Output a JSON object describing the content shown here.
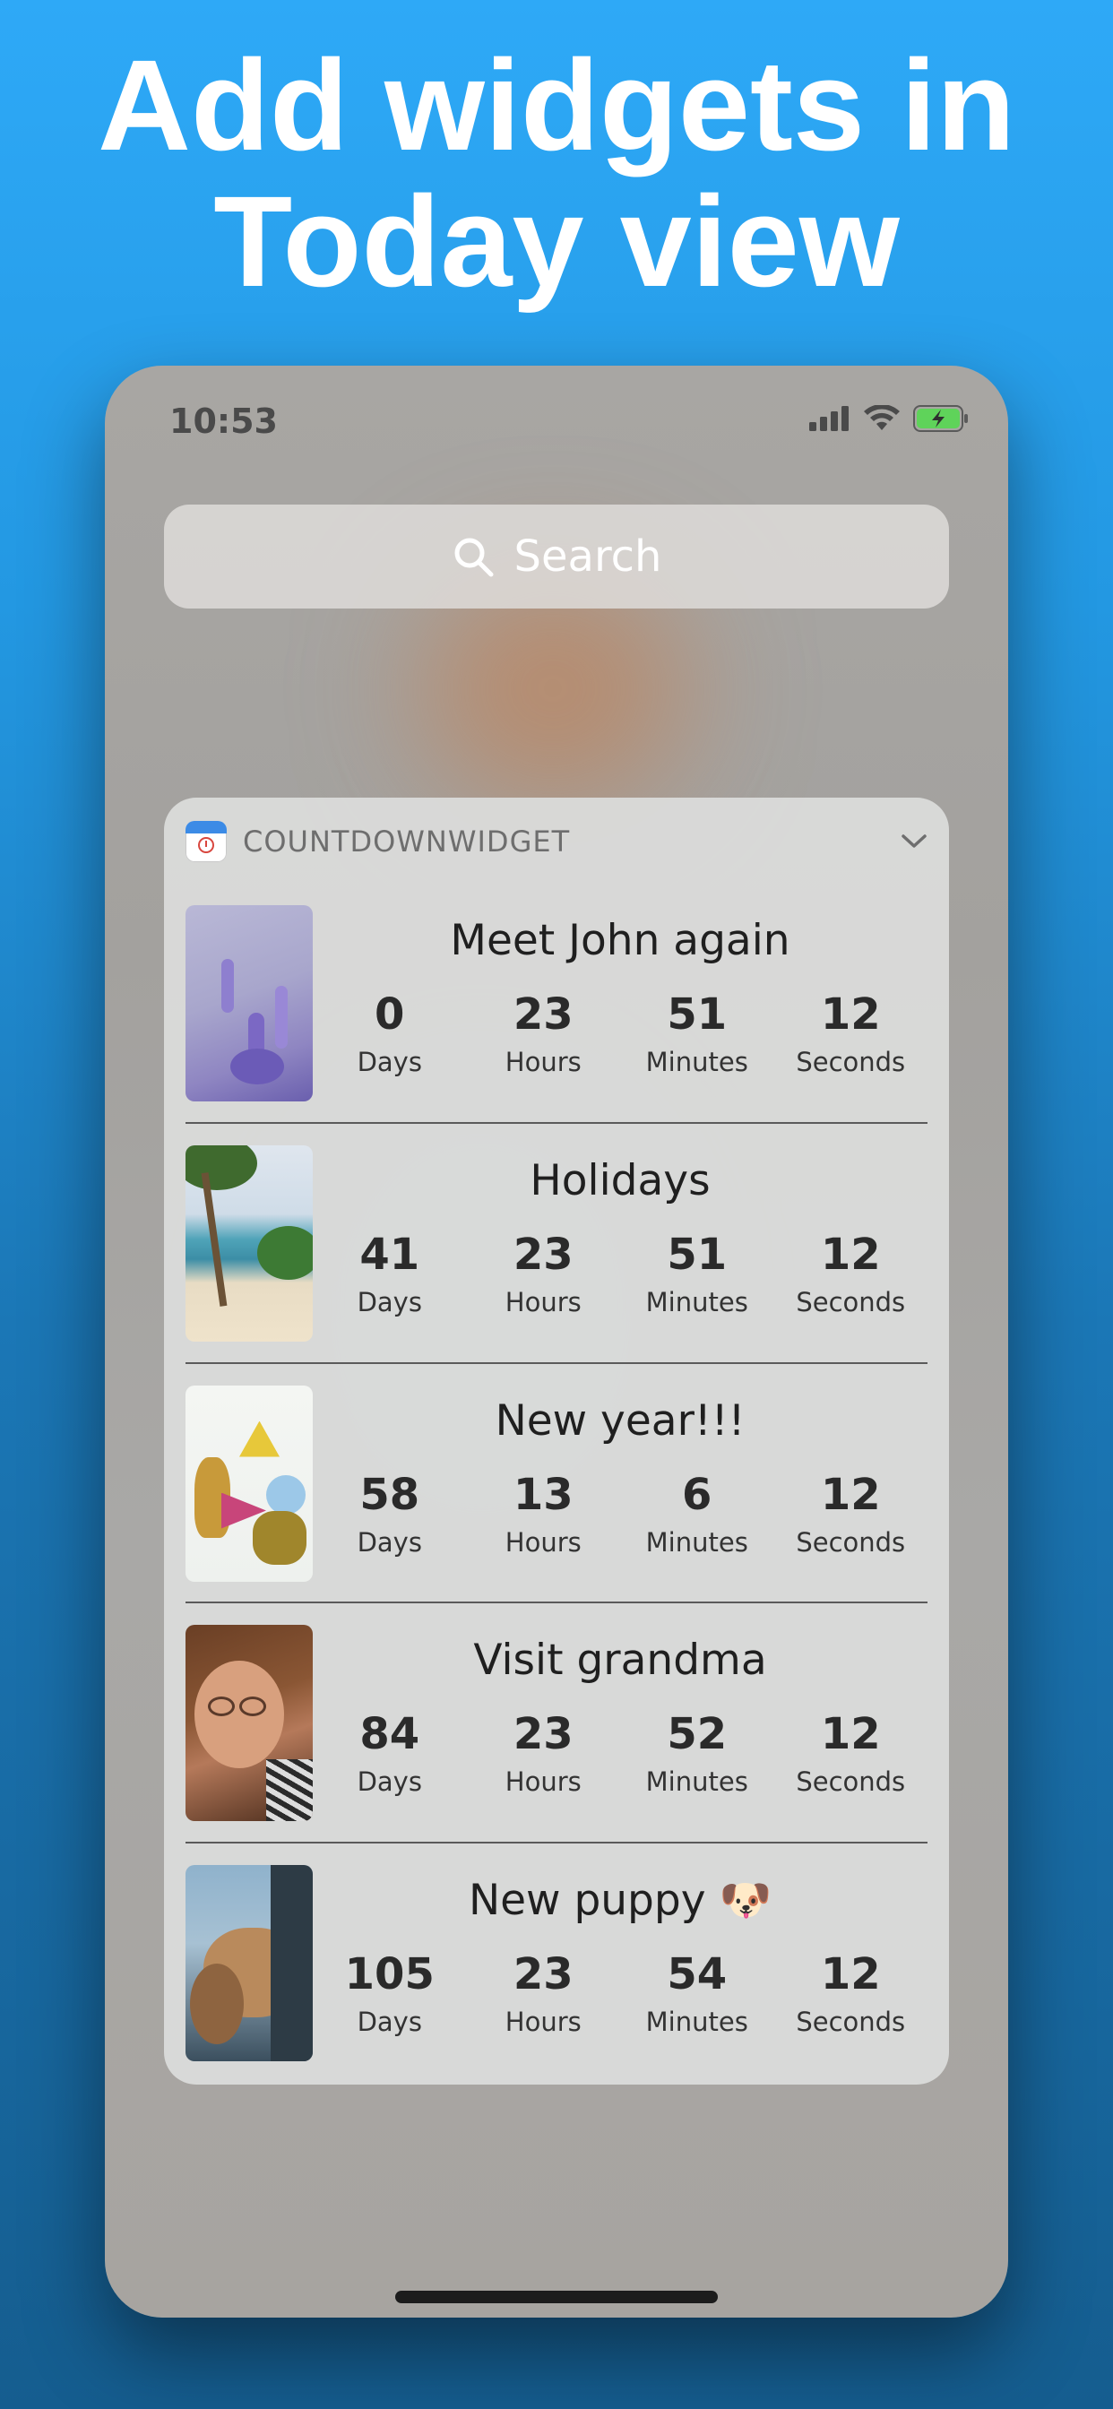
{
  "headline": {
    "line1": "Add widgets in",
    "line2": "Today view"
  },
  "status_bar": {
    "time": "10:53"
  },
  "search": {
    "label": "Search"
  },
  "widget": {
    "app_name": "COUNTDOWNWIDGET",
    "events": [
      {
        "title": "Meet John again",
        "days": "0",
        "hours": "23",
        "minutes": "51",
        "seconds": "12",
        "image": "lavender-photo"
      },
      {
        "title": "Holidays",
        "days": "41",
        "hours": "23",
        "minutes": "51",
        "seconds": "12",
        "image": "beach-palm-photo"
      },
      {
        "title": "New year!!!",
        "days": "58",
        "hours": "13",
        "minutes": "6",
        "seconds": "12",
        "image": "party-pineapples-photo"
      },
      {
        "title": "Visit grandma",
        "days": "84",
        "hours": "23",
        "minutes": "52",
        "seconds": "12",
        "image": "grandma-hug-photo"
      },
      {
        "title": "New puppy 🐶",
        "days": "105",
        "hours": "23",
        "minutes": "54",
        "seconds": "12",
        "image": "dog-in-car-photo"
      }
    ],
    "unit_labels": {
      "days": "Days",
      "hours": "Hours",
      "minutes": "Minutes",
      "seconds": "Seconds"
    }
  },
  "colors": {
    "background_top": "#2ea9f7",
    "background_bottom": "#155d8f",
    "battery_green": "#5fd35a"
  }
}
